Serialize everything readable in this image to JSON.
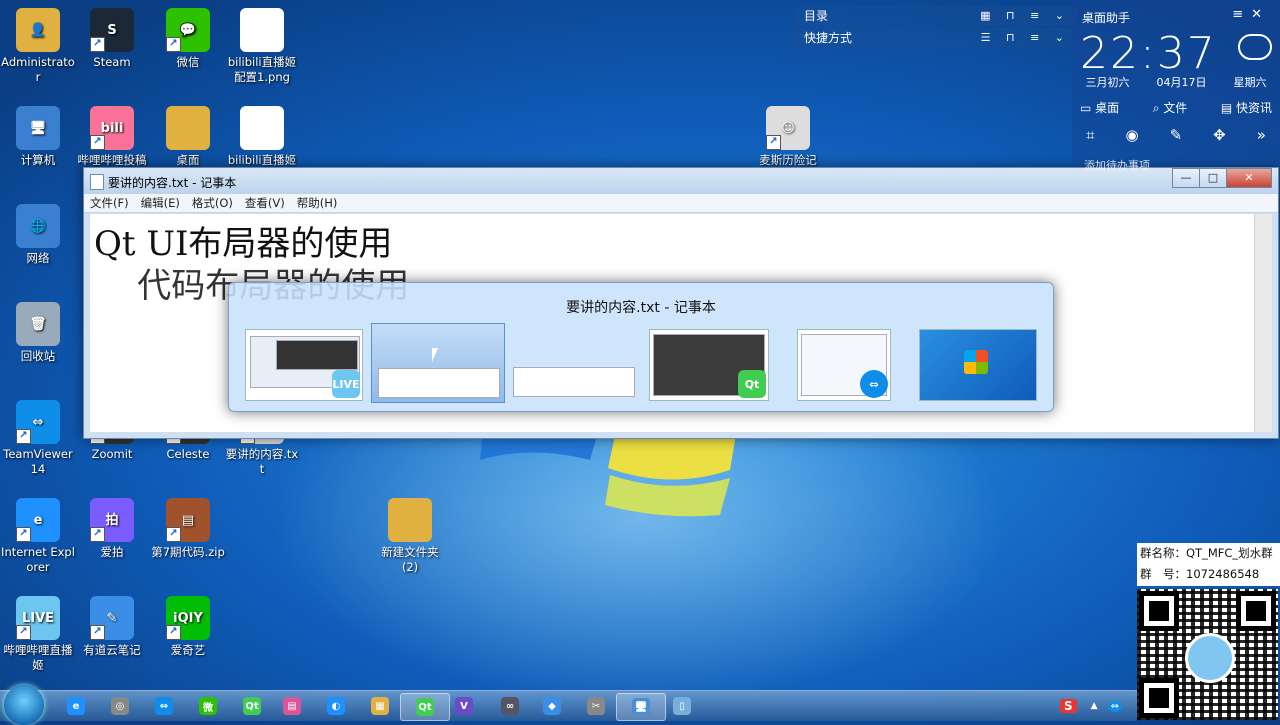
{
  "desktop_icons": [
    {
      "label": "Administrator",
      "color": "#e0b040",
      "glyph": "👤"
    },
    {
      "label": "Steam",
      "color": "#1b2838",
      "glyph": "S"
    },
    {
      "label": "微信",
      "color": "#2dc100",
      "glyph": "💬"
    },
    {
      "label": "bilibili直播姬配置1.png",
      "color": "#ffffff",
      "glyph": ""
    },
    {
      "label": "计算机",
      "color": "#3b7fd1",
      "glyph": "🖥"
    },
    {
      "label": "哔哩哔哩投稿",
      "color": "#fb7299",
      "glyph": "bili"
    },
    {
      "label": "桌面",
      "color": "#e0b040",
      "glyph": ""
    },
    {
      "label": "bilibili直播姬",
      "color": "#ffffff",
      "glyph": ""
    },
    {
      "label": "网络",
      "color": "#3b7fd1",
      "glyph": "🌐"
    },
    {
      "label": "回收站",
      "color": "#9ab",
      "glyph": "🗑"
    },
    {
      "label": "麦斯历险记",
      "color": "#ddd",
      "glyph": "☺"
    },
    {
      "label": "TeamViewer14",
      "color": "#0e8ee9",
      "glyph": "⇔"
    },
    {
      "label": "Zoomit",
      "color": "#333",
      "glyph": ""
    },
    {
      "label": "Celeste",
      "color": "#333",
      "glyph": ""
    },
    {
      "label": "要讲的内容.txt",
      "color": "#ddd",
      "glyph": ""
    },
    {
      "label": "Internet Explorer",
      "color": "#1e90ff",
      "glyph": "e"
    },
    {
      "label": "爱拍",
      "color": "#7b5cff",
      "glyph": "拍"
    },
    {
      "label": "第7期代码.zip",
      "color": "#a0522d",
      "glyph": "▤"
    },
    {
      "label": "新建文件夹 (2)",
      "color": "#e0b040",
      "glyph": ""
    },
    {
      "label": "哔哩哔哩直播姬",
      "color": "#6cc6f0",
      "glyph": "LIVE"
    },
    {
      "label": "有道云笔记",
      "color": "#3a8ee6",
      "glyph": "✎"
    },
    {
      "label": "爱奇艺",
      "color": "#00be06",
      "glyph": "iQIY"
    }
  ],
  "notepad": {
    "title": "要讲的内容.txt - 记事本",
    "menu": [
      "文件(F)",
      "编辑(E)",
      "格式(O)",
      "查看(V)",
      "帮助(H)"
    ],
    "lines": [
      "Qt UI布局器的使用",
      "    代码布局器的使用"
    ],
    "buttons": {
      "minimize": "—",
      "maximize": "□",
      "close": "✕"
    }
  },
  "switcher": {
    "title": "要讲的内容.txt - 记事本",
    "thumb_badges": [
      "LIVE",
      "",
      "",
      "Qt",
      "⇔",
      ""
    ]
  },
  "topmenus": [
    {
      "label": "目录"
    },
    {
      "label": "快捷方式"
    }
  ],
  "widget": {
    "header": "桌面助手",
    "time": "22:37",
    "lunar": "三月初六",
    "date": "04月17日",
    "weekday": "星期六",
    "links": [
      "桌面",
      "文件",
      "快资讯"
    ],
    "todo": "添加待办事项"
  },
  "group": {
    "name": "群名称：QT_MFC_划水群",
    "number": "群　号：1072486548"
  },
  "taskbar": {
    "items": [
      {
        "glyph": "e",
        "color": "#1e90ff"
      },
      {
        "glyph": "◎",
        "color": "#888"
      },
      {
        "glyph": "⇔",
        "color": "#0e8ee9"
      },
      {
        "glyph": "微",
        "color": "#2dc100"
      },
      {
        "glyph": "Qt",
        "color": "#41cd52"
      },
      {
        "glyph": "▤",
        "color": "#d59"
      },
      {
        "glyph": "◐",
        "color": "#1e90ff"
      },
      {
        "glyph": "▦",
        "color": "#e0b040"
      },
      {
        "glyph": "Qt",
        "color": "#41cd52"
      },
      {
        "glyph": "V",
        "color": "#6a4cc7"
      },
      {
        "glyph": "∞",
        "color": "#556"
      },
      {
        "glyph": "◆",
        "color": "#3a8ee6"
      },
      {
        "glyph": "✂",
        "color": "#888"
      },
      {
        "glyph": "🖥",
        "color": "#4a8fd0"
      },
      {
        "glyph": "▯",
        "color": "#7aaedb"
      }
    ],
    "tray": [
      "S",
      "▲",
      "⇔"
    ]
  }
}
